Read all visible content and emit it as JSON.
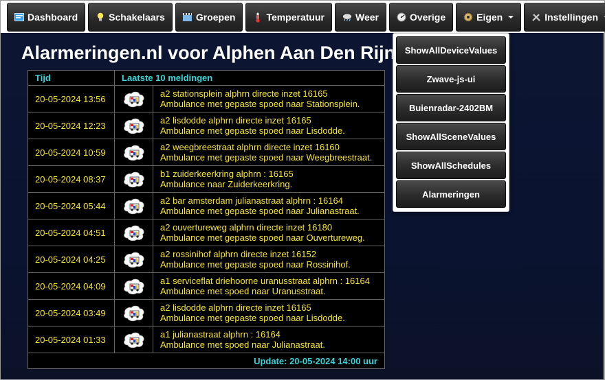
{
  "nav": [
    {
      "label": "Dashboard",
      "icon": "dashboard-icon"
    },
    {
      "label": "Schakelaars",
      "icon": "lightbulb-icon"
    },
    {
      "label": "Groepen",
      "icon": "film-icon"
    },
    {
      "label": "Temperatuur",
      "icon": "thermometer-icon"
    },
    {
      "label": "Weer",
      "icon": "cloud-icon"
    },
    {
      "label": "Overige",
      "icon": "gauge-icon"
    },
    {
      "label": "Eigen",
      "icon": "gear-icon"
    },
    {
      "label": "Instellingen",
      "icon": "tools-icon"
    }
  ],
  "page": {
    "title": "Alarmeringen.nl voor Alphen Aan Den Rijn"
  },
  "table": {
    "col_time": "Tijd",
    "col_messages": "Laatste 10 meldingen",
    "rows": [
      {
        "time": "20-05-2024 13:56",
        "line1": "a2 stationsplein alphrn directe inzet 16165",
        "line2": "Ambulance met gepaste spoed naar Stationsplein."
      },
      {
        "time": "20-05-2024 12:23",
        "line1": "a2 lisdodde alphrn directe inzet 16165",
        "line2": "Ambulance met gepaste spoed naar Lisdodde."
      },
      {
        "time": "20-05-2024 10:59",
        "line1": "a2 weegbreestraat alphrn directe inzet 16160",
        "line2": "Ambulance met gepaste spoed naar Weegbreestraat."
      },
      {
        "time": "20-05-2024 08:37",
        "line1": "b1 zuiderkeerkring alphrn : 16165",
        "line2": "Ambulance naar Zuiderkeerkring."
      },
      {
        "time": "20-05-2024 05:44",
        "line1": "a2 bar amsterdam julianastraat alphrn : 16164",
        "line2": "Ambulance met gepaste spoed naar Julianastraat."
      },
      {
        "time": "20-05-2024 04:51",
        "line1": "a2 ouvertureweg alphrn directe inzet 16180",
        "line2": "Ambulance met gepaste spoed naar Ouvertureweg."
      },
      {
        "time": "20-05-2024 04:25",
        "line1": "a2 rossinihof alphrn directe inzet 16152",
        "line2": "Ambulance met gepaste spoed naar Rossinihof."
      },
      {
        "time": "20-05-2024 04:09",
        "line1": "a1 serviceflat driehoorne uranusstraat alphrn : 16164",
        "line2": "Ambulance met spoed naar Uranusstraat."
      },
      {
        "time": "20-05-2024 03:49",
        "line1": "a2 lisdodde alphrn directe inzet 16165",
        "line2": "Ambulance met gepaste spoed naar Lisdodde."
      },
      {
        "time": "20-05-2024 01:33",
        "line1": "a1 julianastraat alphrn : 16164",
        "line2": "Ambulance met spoed naar Julianastraat."
      }
    ],
    "update": "Update: 20-05-2024 14:00 uur"
  },
  "dropdown": {
    "items": [
      "ShowAllDeviceValues",
      "Zwave-js-ui",
      "Buienradar-2402BM",
      "ShowAllSceneValues",
      "ShowAllSchedules",
      "Alarmeringen"
    ]
  },
  "colors": {
    "accent_cyan": "#3ad3d9",
    "text_yellow": "#f5e33a",
    "background": "#0c1633"
  }
}
